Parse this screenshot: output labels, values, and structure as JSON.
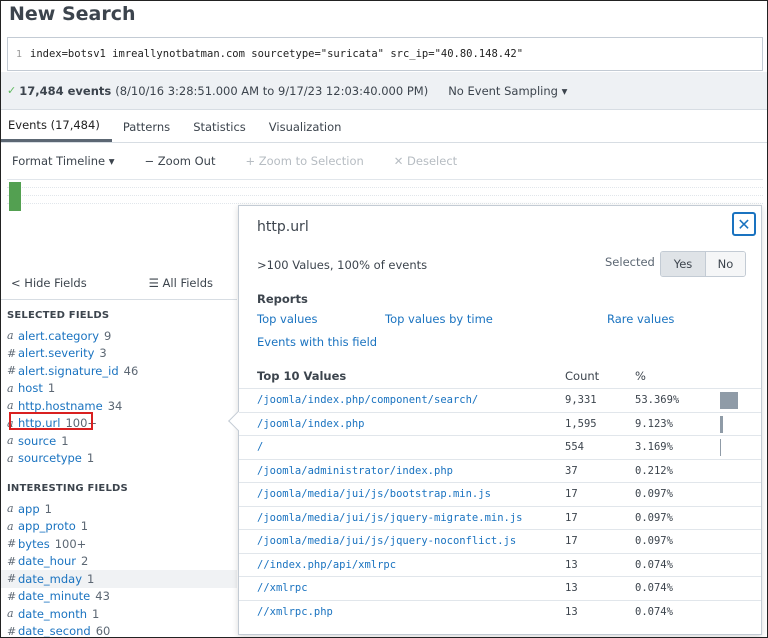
{
  "page_title": "New Search",
  "search": {
    "line_number": "1",
    "query": "index=botsv1 imreallynotbatman.com sourcetype=\"suricata\" src_ip=\"40.80.148.42\""
  },
  "summary": {
    "event_count": "17,484 events",
    "time_range": "(8/10/16 3:28:51.000 AM to 9/17/23 12:03:40.000 PM)",
    "sampling": "No Event Sampling ▾"
  },
  "tabs": [
    {
      "label": "Events (17,484)"
    },
    {
      "label": "Patterns"
    },
    {
      "label": "Statistics"
    },
    {
      "label": "Visualization"
    }
  ],
  "timeline": {
    "format": "Format Timeline ▾",
    "zoom_out": "− Zoom Out",
    "zoom_selection": "+ Zoom to Selection",
    "deselect": "✕ Deselect"
  },
  "fields_panel": {
    "hide_fields": "< Hide Fields",
    "all_fields": "☰ All Fields",
    "selected_title": "SELECTED FIELDS",
    "interesting_title": "INTERESTING FIELDS",
    "selected": [
      {
        "type": "a",
        "name": "alert.category",
        "count": "9"
      },
      {
        "type": "#",
        "name": "alert.severity",
        "count": "3"
      },
      {
        "type": "#",
        "name": "alert.signature_id",
        "count": "46"
      },
      {
        "type": "a",
        "name": "host",
        "count": "1"
      },
      {
        "type": "a",
        "name": "http.hostname",
        "count": "34"
      },
      {
        "type": "a",
        "name": "http.url",
        "count": "100+"
      },
      {
        "type": "a",
        "name": "source",
        "count": "1"
      },
      {
        "type": "a",
        "name": "sourcetype",
        "count": "1"
      }
    ],
    "interesting": [
      {
        "type": "a",
        "name": "app",
        "count": "1"
      },
      {
        "type": "a",
        "name": "app_proto",
        "count": "1"
      },
      {
        "type": "#",
        "name": "bytes",
        "count": "100+"
      },
      {
        "type": "#",
        "name": "date_hour",
        "count": "2"
      },
      {
        "type": "#",
        "name": "date_mday",
        "count": "1"
      },
      {
        "type": "#",
        "name": "date_minute",
        "count": "43"
      },
      {
        "type": "a",
        "name": "date_month",
        "count": "1"
      },
      {
        "type": "#",
        "name": "date_second",
        "count": "60"
      }
    ]
  },
  "popup": {
    "title": "http.url",
    "summary": ">100 Values, 100% of events",
    "selected_label": "Selected",
    "yes": "Yes",
    "no": "No",
    "reports_label": "Reports",
    "reports": {
      "top_values": "Top values",
      "top_by_time": "Top values by time",
      "rare_values": "Rare values",
      "events_with_field": "Events with this field"
    },
    "top_label": "Top 10 Values",
    "col_count": "Count",
    "col_pct": "%",
    "values": [
      {
        "value": "/joomla/index.php/component/search/",
        "count": "9,331",
        "pct": "53.369%",
        "share": 0.53369
      },
      {
        "value": "/joomla/index.php",
        "count": "1,595",
        "pct": "9.123%",
        "share": 0.09123
      },
      {
        "value": "/",
        "count": "554",
        "pct": "3.169%",
        "share": 0.03169
      },
      {
        "value": "/joomla/administrator/index.php",
        "count": "37",
        "pct": "0.212%",
        "share": 0.00212
      },
      {
        "value": "/joomla/media/jui/js/bootstrap.min.js",
        "count": "17",
        "pct": "0.097%",
        "share": 0.00097
      },
      {
        "value": "/joomla/media/jui/js/jquery-migrate.min.js",
        "count": "17",
        "pct": "0.097%",
        "share": 0.00097
      },
      {
        "value": "/joomla/media/jui/js/jquery-noconflict.js",
        "count": "17",
        "pct": "0.097%",
        "share": 0.00097
      },
      {
        "value": "//index.php/api/xmlrpc",
        "count": "13",
        "pct": "0.074%",
        "share": 0.00074
      },
      {
        "value": "//xmlrpc",
        "count": "13",
        "pct": "0.074%",
        "share": 0.00074
      },
      {
        "value": "//xmlrpc.php",
        "count": "13",
        "pct": "0.074%",
        "share": 0.00074
      }
    ]
  }
}
